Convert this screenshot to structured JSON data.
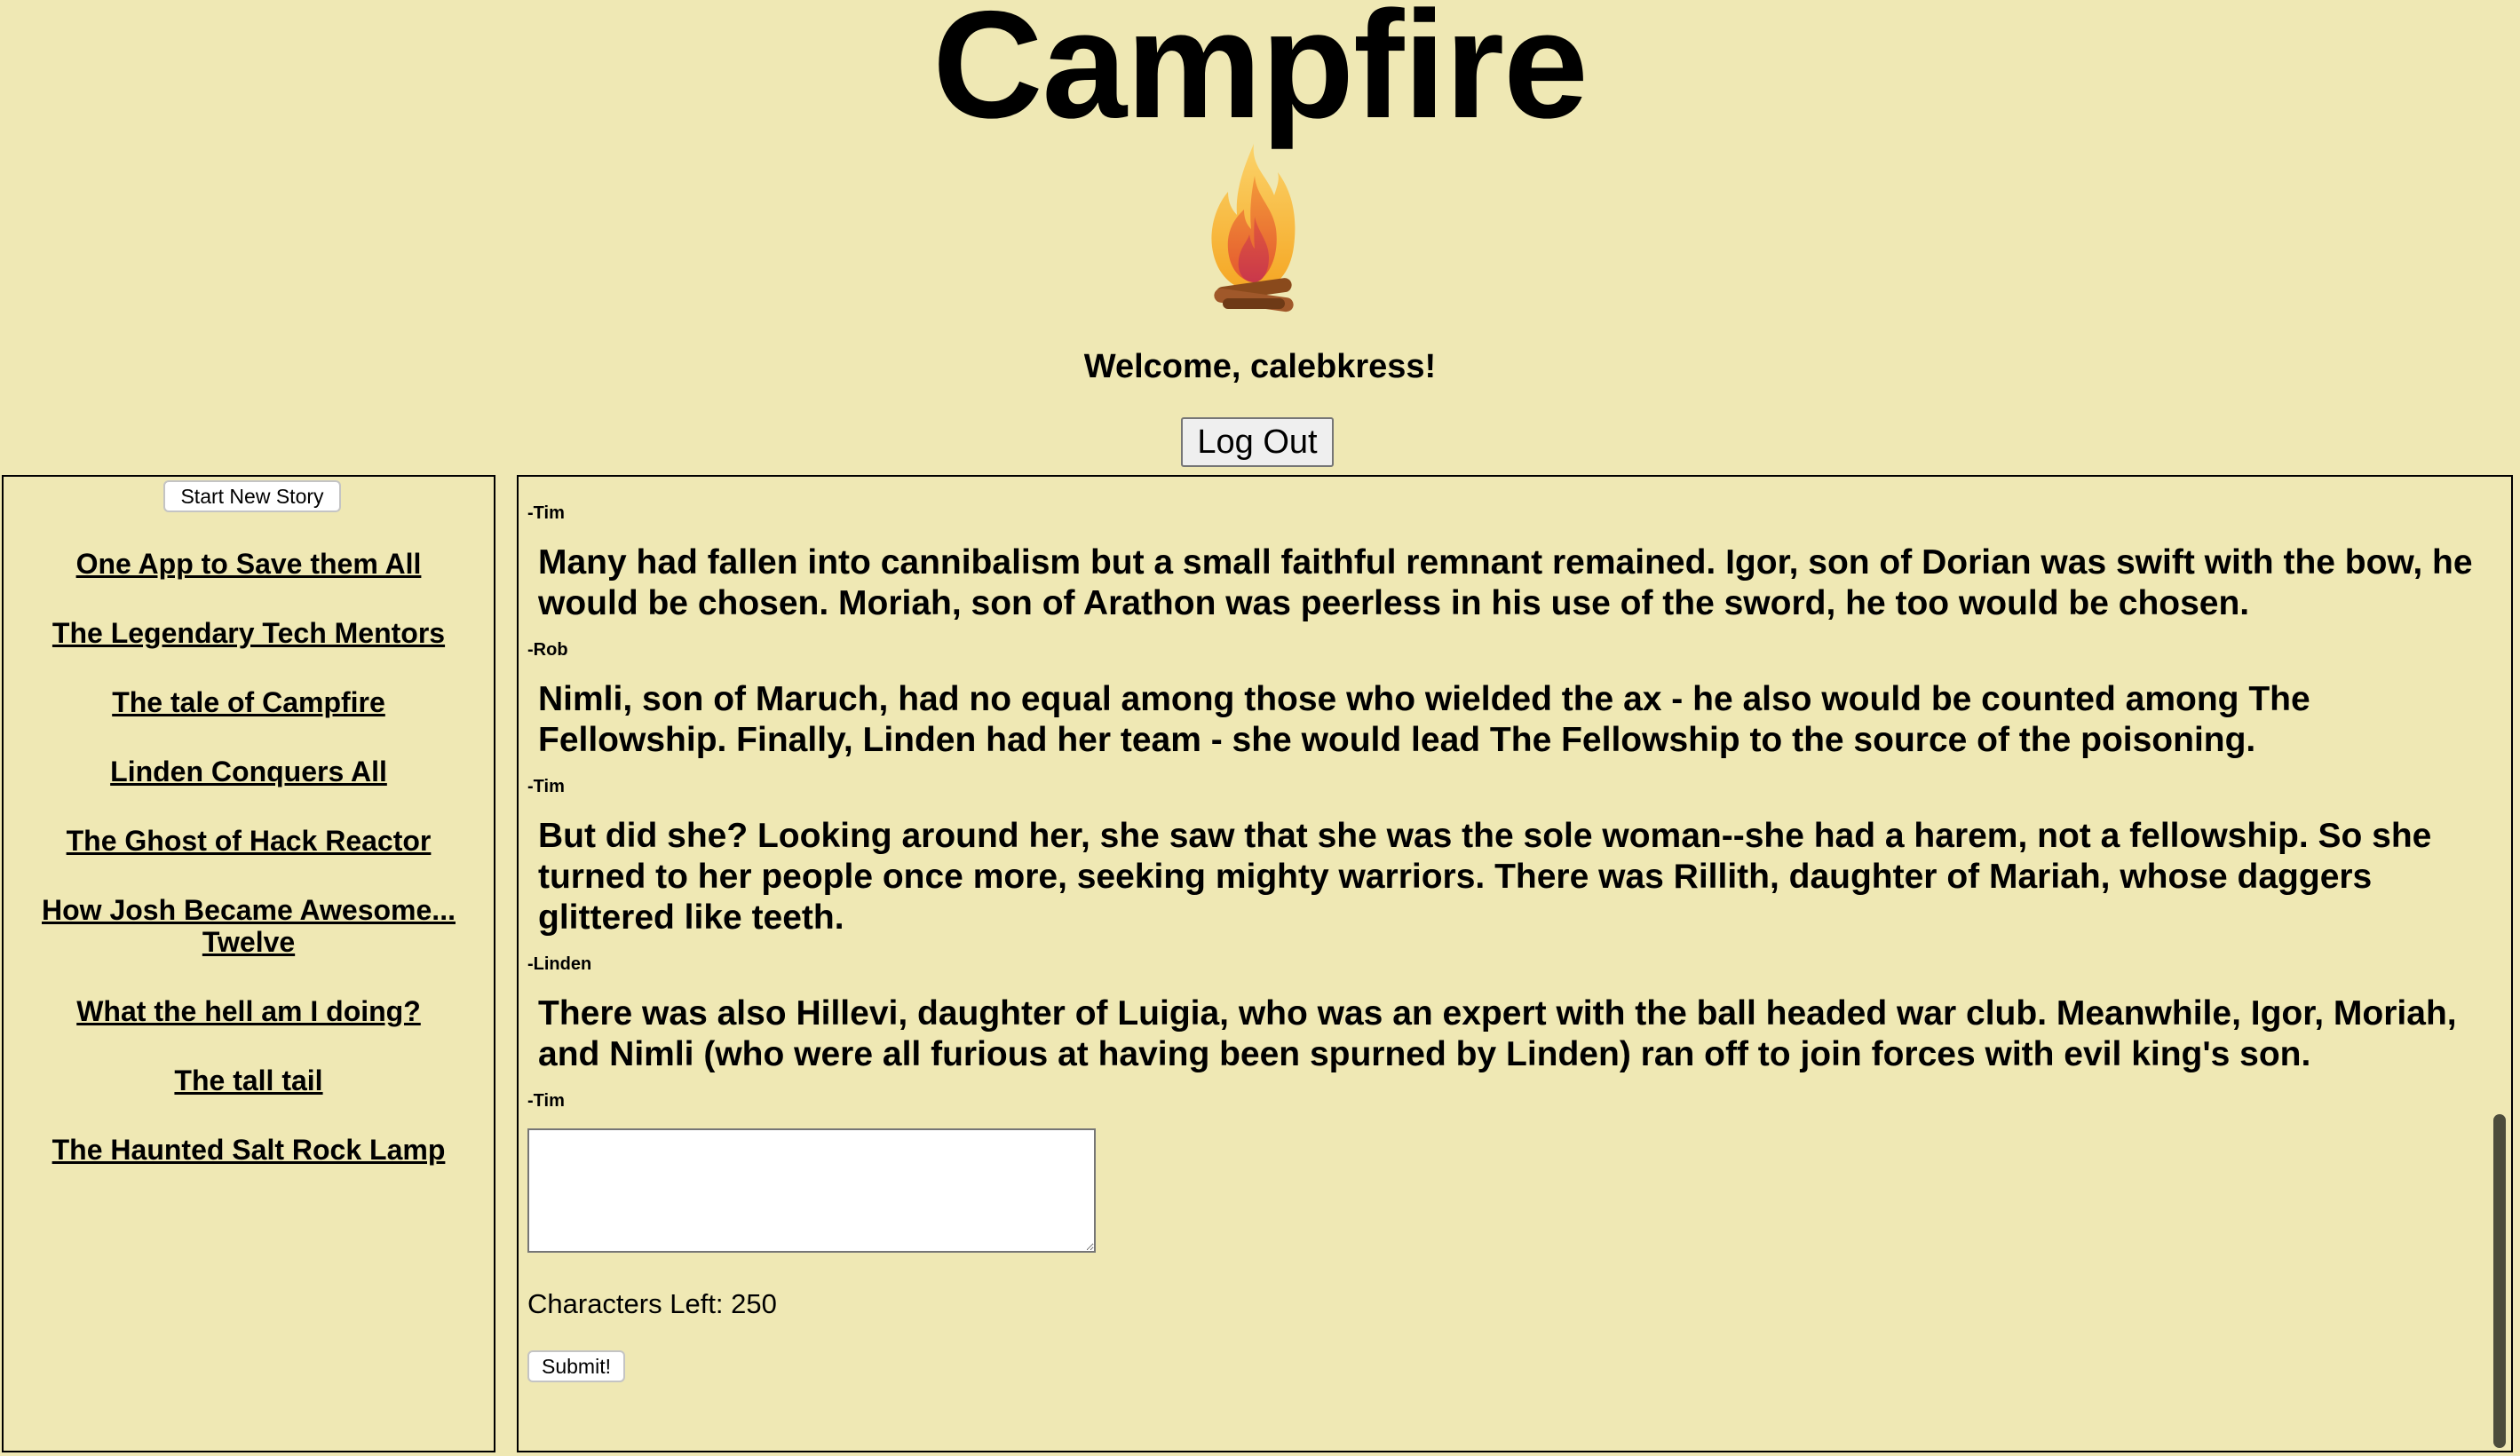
{
  "header": {
    "title": "Campfire",
    "welcome": "Welcome, calebkress!",
    "logout_label": "Log Out",
    "logo_icon": "campfire-icon"
  },
  "sidebar": {
    "new_story_label": "Start New Story",
    "stories": [
      "One App to Save them All",
      "The Legendary Tech Mentors",
      "The tale of Campfire",
      "Linden Conquers All",
      "The Ghost of Hack Reactor",
      "How Josh Became Awesome... Twelve",
      "What the hell am I doing?",
      "The tall tail",
      "The Haunted Salt Rock Lamp"
    ]
  },
  "story": {
    "entries": [
      {
        "author": "-Tim",
        "text": "Many had fallen into cannibalism but a small faithful remnant remained. Igor, son of Dorian was swift with the bow, he would be chosen. Moriah, son of Arathon was peerless in his use of the sword, he too would be chosen."
      },
      {
        "author": "-Rob",
        "text": "Nimli, son of Maruch, had no equal among those who wielded the ax - he also would be counted among The Fellowship. Finally, Linden had her team - she would lead The Fellowship to the source of the poisoning."
      },
      {
        "author": "-Tim",
        "text": "But did she? Looking around her, she saw that she was the sole woman--she had a harem, not a fellowship. So she turned to her people once more, seeking mighty warriors. There was Rillith, daughter of Mariah, whose daggers glittered like teeth."
      },
      {
        "author": "-Linden",
        "text": "There was also Hillevi, daughter of Luigia, who was an expert with the ball headed war club. Meanwhile, Igor, Moriah, and Nimli (who were all furious at having been spurned by Linden) ran off to join forces with evil king's son."
      }
    ],
    "last_author": "-Tim",
    "input_value": "",
    "chars_left": "Characters Left: 250",
    "submit_label": "Submit!"
  },
  "colors": {
    "background": "#efe8b4",
    "text": "#000000"
  }
}
